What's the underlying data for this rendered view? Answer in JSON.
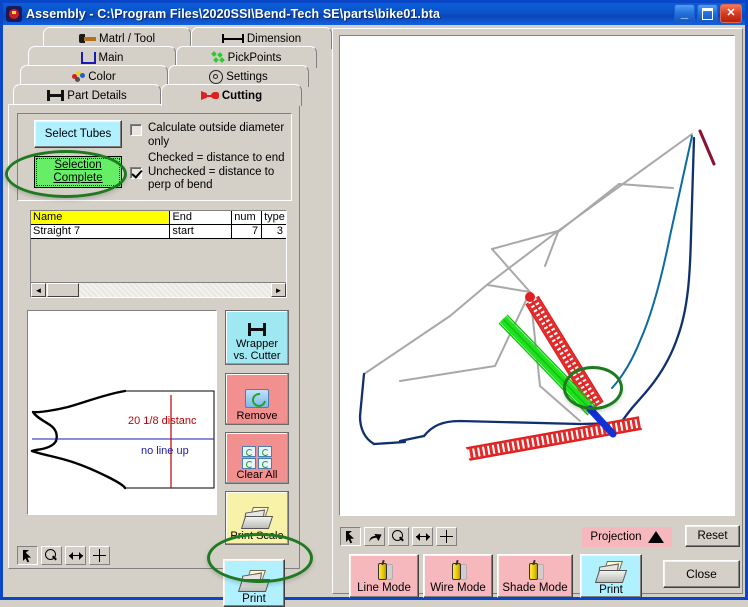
{
  "window": {
    "title": "Assembly  -  C:\\Program Files\\2020SSI\\Bend-Tech SE\\parts\\bike01.bta",
    "icon": "app-icon",
    "minimize_label": "_",
    "maximize_label": "",
    "close_label": "✕"
  },
  "tabs": {
    "row1": [
      {
        "label": "Matrl / Tool",
        "icon": "hammer-icon",
        "active": false
      },
      {
        "label": "Dimension",
        "icon": "dimension-icon",
        "active": false
      }
    ],
    "row2": [
      {
        "label": "Main",
        "icon": "main-icon",
        "active": false
      },
      {
        "label": "PickPoints",
        "icon": "pickpoints-icon",
        "active": false
      }
    ],
    "row3": [
      {
        "label": "Color",
        "icon": "color-palette-icon",
        "active": false
      },
      {
        "label": "Settings",
        "icon": "gear-icon",
        "active": false
      }
    ],
    "row4": [
      {
        "label": "Part Details",
        "icon": "part-details-icon",
        "active": false
      },
      {
        "label": "Cutting",
        "icon": "cutting-icon",
        "active": true
      }
    ]
  },
  "cutting_panel": {
    "select_tubes_label": "Select Tubes",
    "selection_complete_line1": "Selection",
    "selection_complete_line2": "Complete",
    "checkbox_outside_diameter": {
      "label": "Calculate outside diameter only",
      "checked": false
    },
    "checkbox_distance_mode": {
      "label_line1": "Checked = distance to end",
      "label_line2": "Unchecked = distance to",
      "label_line3": "perp of bend",
      "checked": true
    },
    "grid": {
      "columns": [
        "Name",
        "End",
        "num",
        "type"
      ],
      "rows": [
        {
          "name": "Straight 7",
          "end": "start",
          "num": "7",
          "type": "3"
        }
      ],
      "scroll_left_arrow": "◄",
      "scroll_right_arrow": "►"
    },
    "drawing": {
      "dimension_text": "20  1/8 distanc",
      "lineup_text": "no line up"
    },
    "buttons": {
      "wrapper_vs_cutter_line1": "Wrapper",
      "wrapper_vs_cutter_line2": "vs. Cutter",
      "remove": "Remove",
      "clear_all": "Clear All",
      "print_scale": "Print Scale",
      "print": "Print"
    },
    "toolbar": [
      {
        "icon": "select-arrow-icon",
        "pressed": true
      },
      {
        "icon": "magnifier-zoom-icon",
        "pressed": false
      },
      {
        "icon": "fit-horizontal-icon",
        "pressed": false
      },
      {
        "icon": "pan-move-icon",
        "pressed": false
      }
    ]
  },
  "viewer_panel": {
    "toolbar": [
      {
        "icon": "select-arrow-icon",
        "pressed": true
      },
      {
        "icon": "rotate-icon",
        "pressed": false
      },
      {
        "icon": "magnifier-zoom-icon",
        "pressed": false
      },
      {
        "icon": "fit-horizontal-icon",
        "pressed": false
      },
      {
        "icon": "pan-move-icon",
        "pressed": false
      }
    ],
    "projection_label": "Projection",
    "projection_icon": "triangle-up-icon",
    "reset_label": "Reset",
    "line_mode_label": "Line Mode",
    "wire_mode_label": "Wire Mode",
    "shade_mode_label": "Shade Mode",
    "print_label": "Print",
    "close_label": "Close"
  },
  "colors": {
    "highlight_ring": "#1f7a1f",
    "cyan_button": "#b0f0ff",
    "green_button": "#66ee66",
    "pink_button": "#f7b8bd",
    "red_button": "#f28f8f",
    "yellow_button": "#f7f2a8",
    "grid_header_highlight": "#ffff00",
    "titlebar": "#0a52c8"
  }
}
